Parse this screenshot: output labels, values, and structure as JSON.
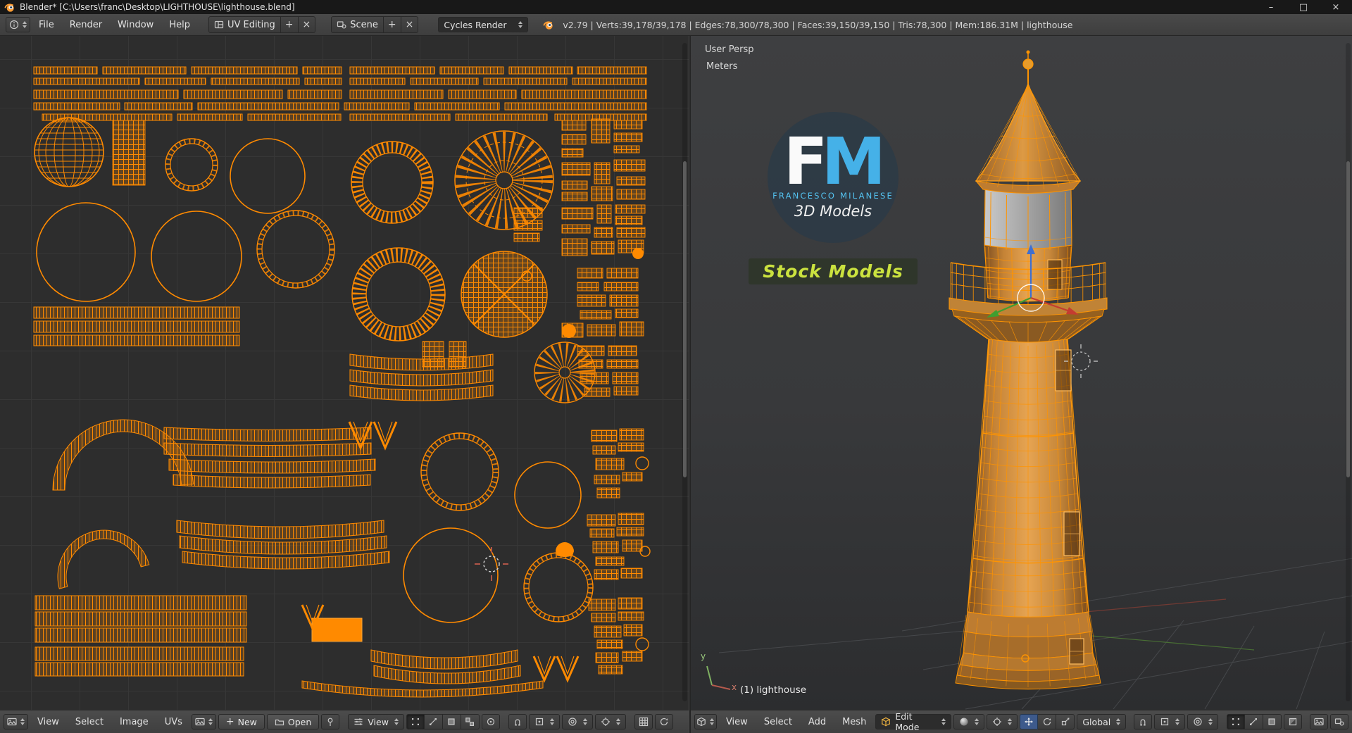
{
  "window": {
    "title": "Blender* [C:\\Users\\franc\\Desktop\\LIGHTHOUSE\\lighthouse.blend]"
  },
  "icons": {
    "minimize": "–",
    "maximize": "□",
    "close": "×",
    "plus": "+",
    "unlink": "×"
  },
  "info_bar": {
    "menus": [
      "File",
      "Render",
      "Window",
      "Help"
    ],
    "layout_value": "UV Editing",
    "scene_value": "Scene",
    "engine_value": "Cycles Render",
    "stats": "v2.79 | Verts:39,178/39,178 | Edges:78,300/78,300 | Faces:39,150/39,150 | Tris:78,300 | Mem:186.31M | lighthouse"
  },
  "uv_editor": {
    "header": {
      "menus": [
        "View",
        "Select",
        "Image",
        "UVs"
      ],
      "new_button": "New",
      "open_button": "Open",
      "view_dropdown": "View"
    }
  },
  "viewport": {
    "overlay": {
      "view_name": "User Persp",
      "unit": "Meters",
      "active_object": "(1) lighthouse"
    },
    "ax": {
      "x": "x",
      "y": "y"
    },
    "watermark": {
      "f": "F",
      "m": "M",
      "name": "FRANCESCO MILANESE",
      "models": "3D Models",
      "stock": "Stock Models"
    },
    "header": {
      "menus": [
        "View",
        "Select",
        "Add",
        "Mesh"
      ],
      "mode": "Edit Mode",
      "orientation": "Global"
    }
  },
  "colors": {
    "uv_wire_orange": "#ff8a00",
    "mesh_wire_orange": "#ff9400",
    "watermark_blue": "#49b4ea",
    "stock_green": "#cbe23f",
    "manipulator_blue": "#3f6fd0",
    "manipulator_green": "#3f9e30",
    "manipulator_red": "#c43c30"
  }
}
